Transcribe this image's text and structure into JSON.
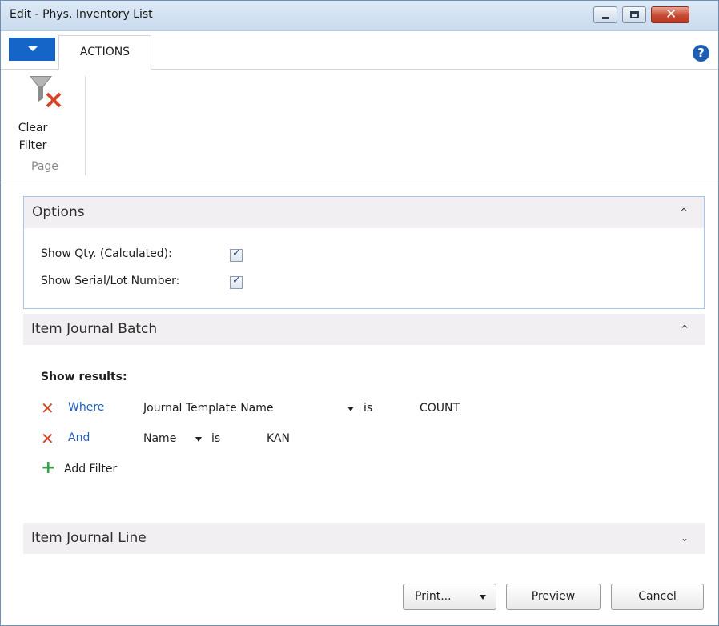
{
  "window": {
    "title": "Edit - Phys. Inventory List",
    "close_glyph": "✕"
  },
  "ribbon": {
    "tab_actions": "ACTIONS",
    "help_glyph": "?",
    "clear_filter": [
      "Clear",
      "Filter"
    ],
    "group_label": "Page"
  },
  "options": {
    "title": "Options",
    "collapse_glyph": "^",
    "fields": [
      {
        "label": "Show Qty. (Calculated):",
        "checked": true
      },
      {
        "label": "Show Serial/Lot Number:",
        "checked": true
      }
    ],
    "check_glyph": "✓"
  },
  "batch": {
    "title": "Item Journal Batch",
    "collapse_glyph": "^",
    "show_results": "Show results:",
    "filters": [
      {
        "connector": "Where",
        "field": "Journal Template Name",
        "operator": "is",
        "value": "COUNT"
      },
      {
        "connector": "And",
        "field": "Name",
        "operator": "is",
        "value": "KAN"
      }
    ],
    "remove_glyph": "✕",
    "add_glyph": "+",
    "add_filter": "Add Filter"
  },
  "line": {
    "title": "Item Journal Line",
    "expand_glyph": "⌄"
  },
  "footer": {
    "print": "Print...",
    "preview": "Preview",
    "cancel": "Cancel"
  },
  "colors": {
    "accent": "#1565c8",
    "link": "#1f5fbf",
    "remove": "#d24726",
    "add": "#3b9c4a"
  }
}
